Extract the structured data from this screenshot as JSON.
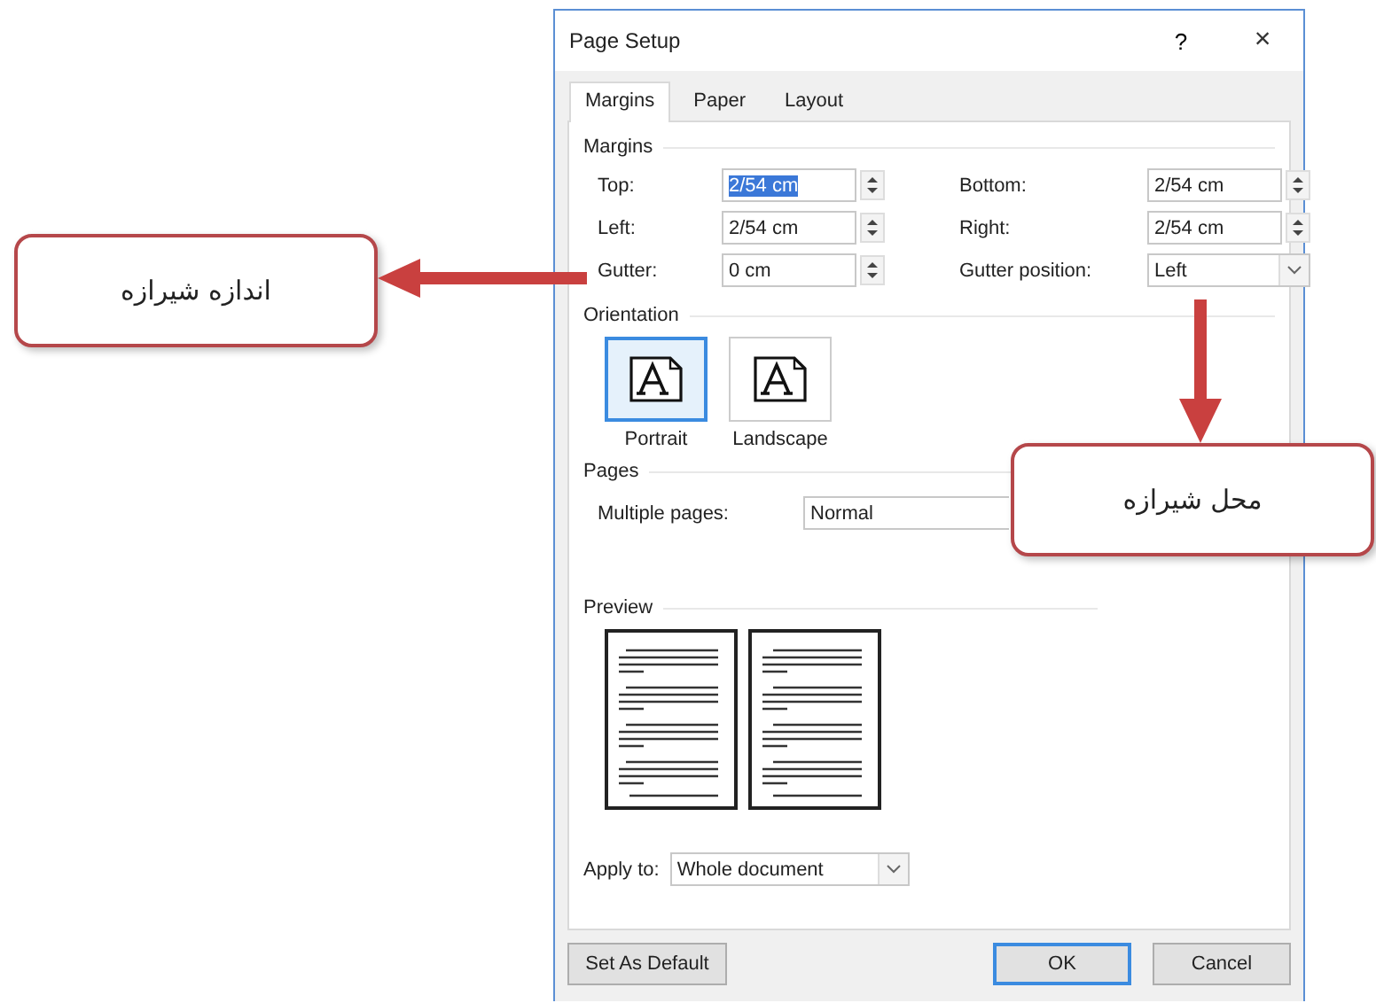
{
  "window": {
    "title": "Page Setup",
    "help_button": "?",
    "close_button": "×"
  },
  "tabs": [
    {
      "label": "Margins",
      "selected": true
    },
    {
      "label": "Paper",
      "selected": false
    },
    {
      "label": "Layout",
      "selected": false
    }
  ],
  "margins": {
    "heading": "Margins",
    "fields": [
      {
        "label": "Top:",
        "value": "2/54 cm",
        "kind": "spin",
        "highlighted": true
      },
      {
        "label": "Bottom:",
        "value": "2/54 cm",
        "kind": "spin",
        "highlighted": false
      },
      {
        "label": "Left:",
        "value": "2/54 cm",
        "kind": "spin",
        "highlighted": false
      },
      {
        "label": "Right:",
        "value": "2/54 cm",
        "kind": "spin",
        "highlighted": false
      },
      {
        "label": "Gutter:",
        "value": "0 cm",
        "kind": "spin",
        "highlighted": false
      },
      {
        "label": "Gutter position:",
        "value": "Left",
        "kind": "dropdown",
        "highlighted": false
      }
    ]
  },
  "orientation": {
    "heading": "Orientation",
    "options": [
      {
        "label": "Portrait",
        "selected": true
      },
      {
        "label": "Landscape",
        "selected": false
      }
    ]
  },
  "pages": {
    "heading": "Pages",
    "multiple_pages": {
      "label": "Multiple pages:",
      "value": "Normal"
    }
  },
  "preview": {
    "heading": "Preview"
  },
  "apply_to": {
    "label": "Apply to:",
    "value": "Whole document"
  },
  "buttons": [
    {
      "label": "Set As Default",
      "default": false
    },
    {
      "label": "OK",
      "default": true
    },
    {
      "label": "Cancel",
      "default": false
    }
  ],
  "callouts": [
    {
      "text": "اندازه شیرازه",
      "kind": "left"
    },
    {
      "text": "محل شیرازه",
      "kind": "down"
    }
  ]
}
